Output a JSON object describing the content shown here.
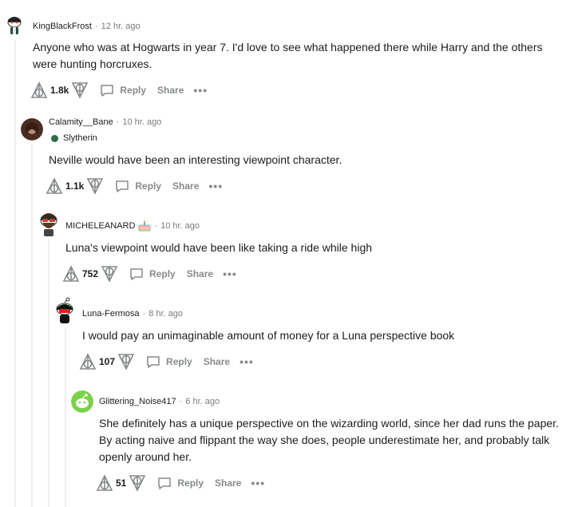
{
  "comments": [
    {
      "user": "KingBlackFrost",
      "time": "12 hr. ago",
      "text": "Anyone who was at Hogwarts in year 7. I'd love to see what happened there while Harry and the others were hunting horcruxes.",
      "score": "1.8k",
      "reply_label": "Reply",
      "share_label": "Share",
      "more_label": "•••"
    },
    {
      "user": "Calamity__Bane",
      "time": "10 hr. ago",
      "flair": "Slytherin",
      "text": "Neville would have been an interesting viewpoint character.",
      "score": "1.1k",
      "reply_label": "Reply",
      "share_label": "Share",
      "more_label": "•••"
    },
    {
      "user": "MICHELEANARD",
      "time": "10 hr. ago",
      "text": "Luna's viewpoint would have been like taking a ride while high",
      "score": "752",
      "reply_label": "Reply",
      "share_label": "Share",
      "more_label": "•••"
    },
    {
      "user": "Luna-Fermosa",
      "time": "8 hr. ago",
      "text": "I would pay an unimaginable amount of money for a Luna perspective book",
      "score": "107",
      "reply_label": "Reply",
      "share_label": "Share",
      "more_label": "•••"
    },
    {
      "user": "Glittering_Noise417",
      "time": "6 hr. ago",
      "text": "She definitely has a unique perspective on the wizarding world, since her dad runs the paper. By acting naive and flippant the way she does, people underestimate her, and probably talk openly around her.",
      "score": "51",
      "reply_label": "Reply",
      "share_label": "Share",
      "more_label": "•••"
    }
  ],
  "icons": {
    "upvote": "deathly-hallows-upvote-icon",
    "downvote": "deathly-hallows-downvote-icon",
    "reply": "speech-bubble-icon",
    "cake": "cake-day-icon",
    "flair": "slytherin-crest-icon"
  },
  "colors": {
    "meta": "#7c7c7c",
    "action": "#878a8c",
    "thread_line": "#edeff1",
    "text": "#1c1c1c"
  }
}
